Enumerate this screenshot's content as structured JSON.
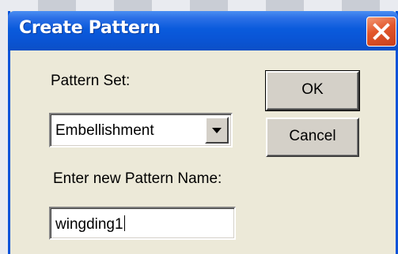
{
  "window": {
    "title": "Create Pattern"
  },
  "pattern_set": {
    "label": "Pattern Set:",
    "selected": "Embellishment"
  },
  "pattern_name": {
    "label": "Enter new Pattern Name:",
    "value": "wingding1"
  },
  "buttons": {
    "ok_label": "OK",
    "cancel_label": "Cancel"
  },
  "icons": {
    "close": "close-icon",
    "dropdown": "chevron-down-icon"
  },
  "colors": {
    "titlebar": "#0a5bdc",
    "close_button": "#e2562b",
    "dialog_face": "#ece9d8"
  }
}
